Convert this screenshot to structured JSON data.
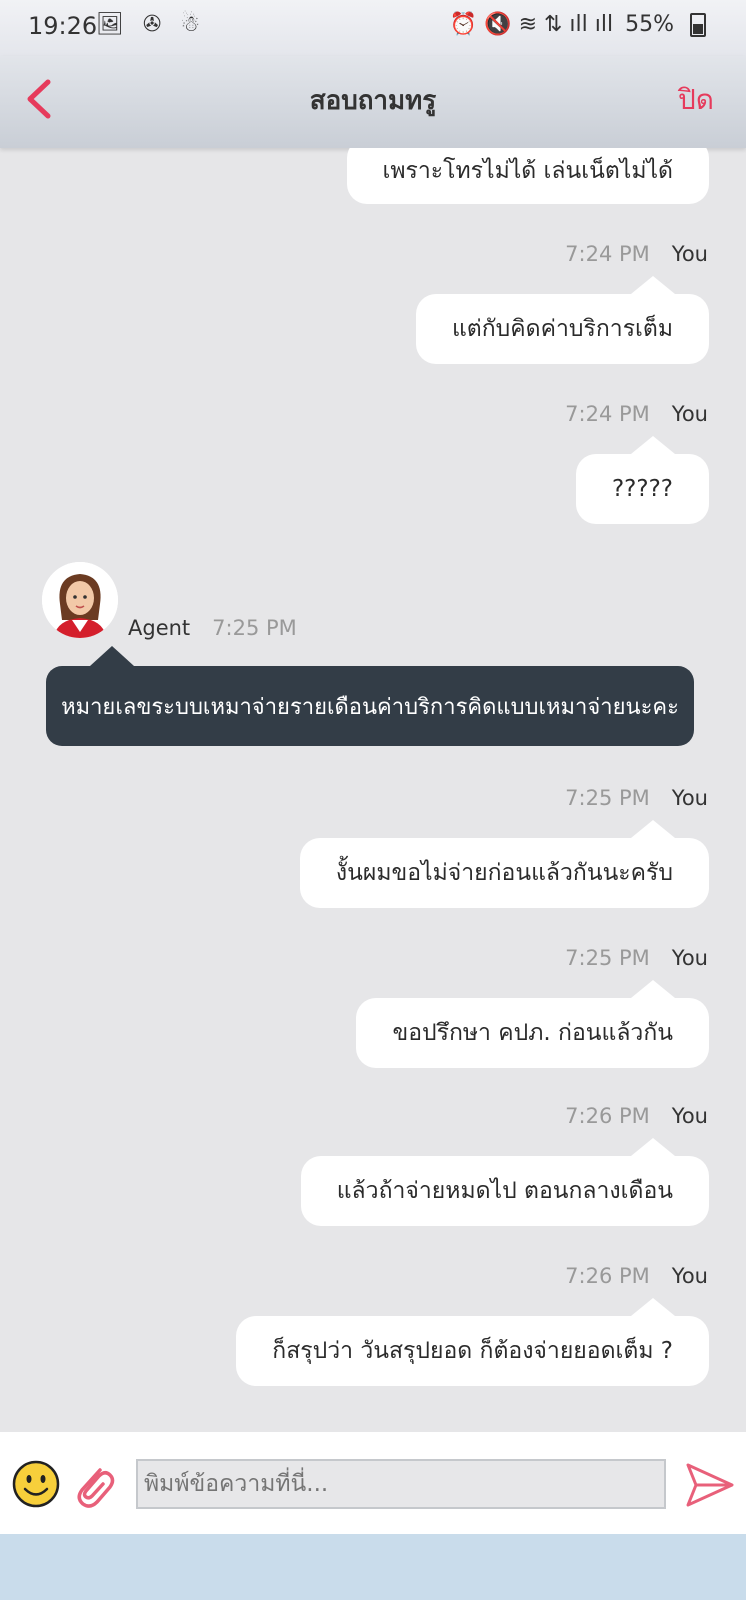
{
  "status_bar": {
    "time": "19:26",
    "left_icons": "🖼 ✇ ☃",
    "right_icons": "⏰ 🔇 ≋ ⇅ ıll ıll",
    "battery": "55%"
  },
  "header": {
    "title": "สอบถามทรู",
    "close_label": "ปิด",
    "accent_color": "#e63b5c"
  },
  "messages": [
    {
      "sender": "You",
      "time": "",
      "text": "เพราะโทรไม่ได้ เล่นเน็ตไม่ได้"
    },
    {
      "sender": "You",
      "time": "7:24 PM",
      "text": "แต่กับคิดค่าบริการเต็ม"
    },
    {
      "sender": "You",
      "time": "7:24 PM",
      "text": "?????"
    },
    {
      "sender": "Agent",
      "time": "7:25 PM",
      "text": "หมายเลขระบบเหมาจ่ายรายเดือนค่าบริการคิดแบบเหมาจ่ายนะคะ"
    },
    {
      "sender": "You",
      "time": "7:25 PM",
      "text": "งั้นผมขอไม่จ่ายก่อนแล้วกันนะครับ"
    },
    {
      "sender": "You",
      "time": "7:25 PM",
      "text": "ขอปรึกษา คปภ. ก่อนแล้วกัน"
    },
    {
      "sender": "You",
      "time": "7:26 PM",
      "text": "แล้วถ้าจ่ายหมดไป ตอนกลางเดือน"
    },
    {
      "sender": "You",
      "time": "7:26 PM",
      "text": "ก็สรุปว่า วันสรุปยอด ก็ต้องจ่ายยอดเต็ม ?"
    }
  ],
  "input": {
    "placeholder": "พิมพ์ข้อความที่นี่..."
  }
}
